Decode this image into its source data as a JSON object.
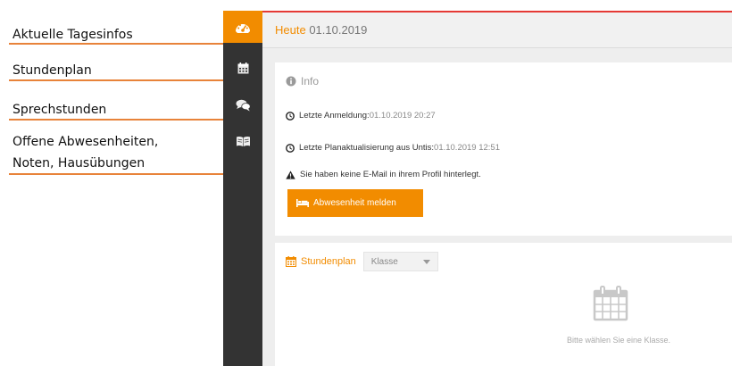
{
  "annotations": [
    {
      "label": "Aktuelle Tagesinfos"
    },
    {
      "label": "Stundenplan"
    },
    {
      "label": "Sprechstunden"
    },
    {
      "label": "Offene Abwesenheiten,"
    },
    {
      "label": "Noten, Hausübungen"
    }
  ],
  "sidebar": {
    "items": [
      {
        "icon": "dashboard-icon",
        "active": true
      },
      {
        "icon": "calendar-icon",
        "active": false
      },
      {
        "icon": "chat-bubbles-icon",
        "active": false
      },
      {
        "icon": "open-book-icon",
        "active": false
      }
    ]
  },
  "header": {
    "label": "Heute",
    "date": "01.10.2019"
  },
  "info": {
    "title": "Info",
    "last_login_label": "Letzte Anmeldung:",
    "last_login_value": "01.10.2019 20:27",
    "last_update_label": "Letzte Planaktualisierung aus Untis:",
    "last_update_value": "01.10.2019 12:51",
    "warning": "Sie haben keine E-Mail in ihrem Profil hinterlegt.",
    "button_label": "Abwesenheit melden"
  },
  "plan": {
    "title": "Stundenplan",
    "select_value": "Klasse",
    "empty_text": "Bitte wählen Sie eine Klasse."
  },
  "colors": {
    "accent": "#f28c00",
    "sidebar": "#333333",
    "top_border": "#e53935",
    "annotation_line": "#e8833a"
  }
}
